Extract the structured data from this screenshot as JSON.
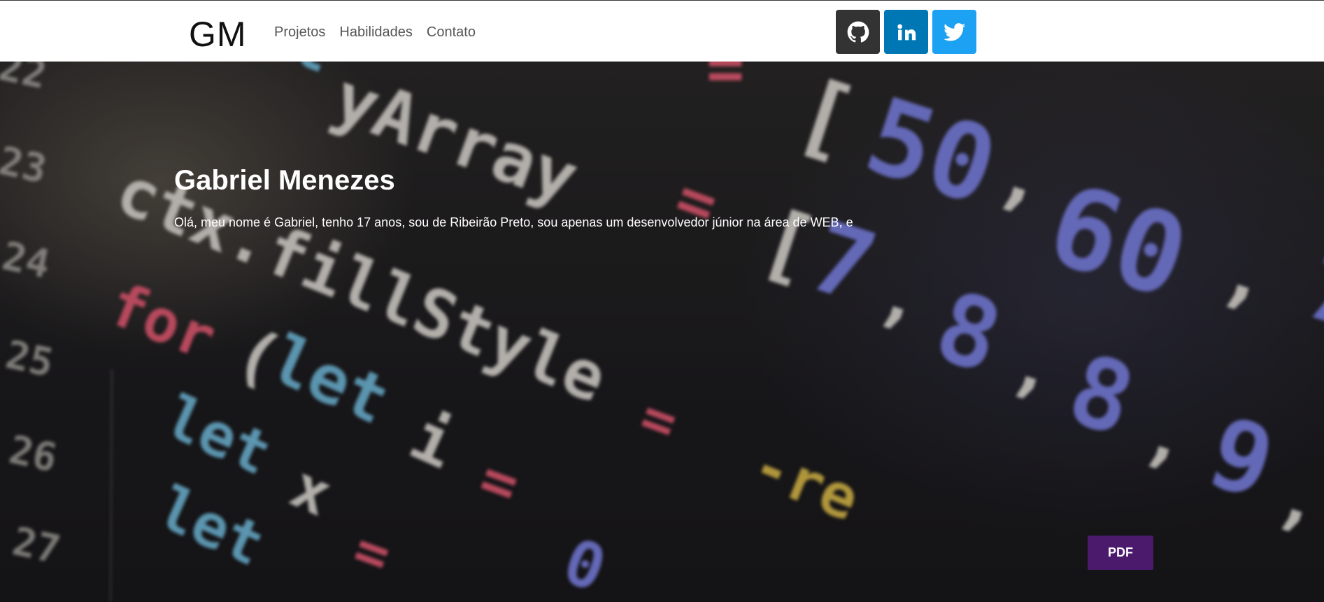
{
  "brand": {
    "logo_text": "GM"
  },
  "nav": {
    "items": [
      {
        "label": "Projetos"
      },
      {
        "label": "Habilidades"
      },
      {
        "label": "Contato"
      }
    ]
  },
  "socials": [
    {
      "name": "github",
      "icon": "github-icon",
      "color": "#333333"
    },
    {
      "name": "linkedin",
      "icon": "linkedin-icon",
      "color": "#0077b5"
    },
    {
      "name": "twitter",
      "icon": "twitter-icon",
      "color": "#1da1f2"
    }
  ],
  "hero": {
    "title": "Gabriel Menezes",
    "text": "Olá, meu nome é Gabriel, tenho 17 anos, sou de Ribeirão Preto, sou apenas um desenvolvedor júnior na área de WEB, e",
    "pdf_label": "PDF",
    "pdf_color": "#4b1a6d"
  },
  "colors": {
    "navbar_bg": "#ffffff",
    "hero_text": "#ffffff"
  }
}
